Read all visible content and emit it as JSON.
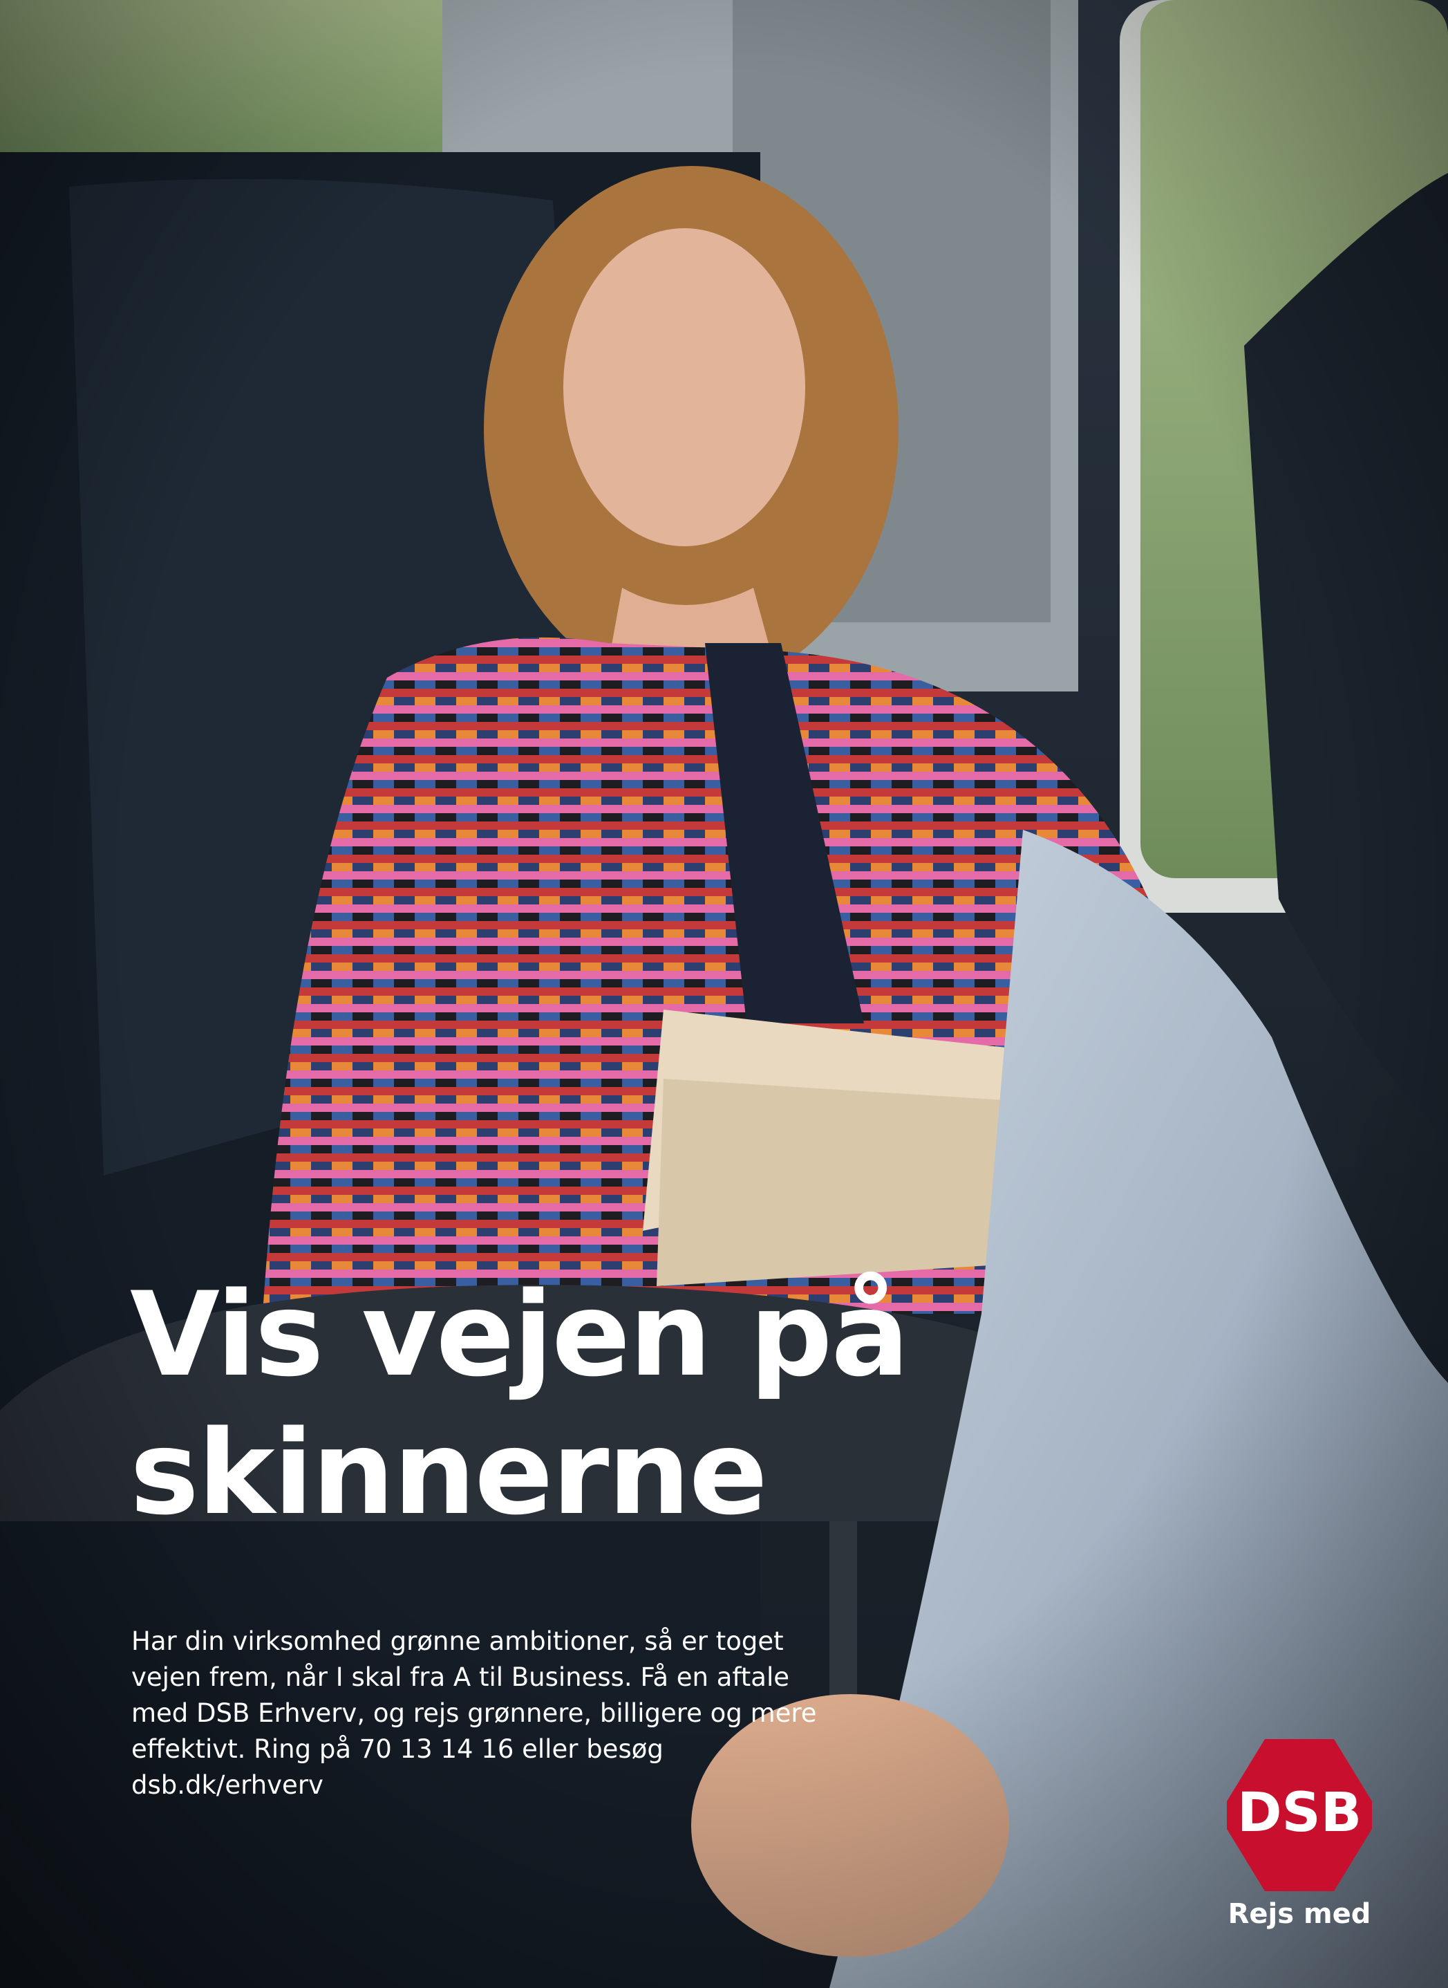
{
  "headline": {
    "line1": "Vis vejen på",
    "line2": "skinnerne"
  },
  "body_text": "Har din virksomhed grønne ambitioner, så er toget vejen frem, når I skal fra A til Business. Få en aftale med DSB Erhverv, og rejs grønnere, billigere og mere effektivt. Ring på 70 13 14 16 eller besøg dsb.dk/erhverv",
  "logo": {
    "text": "DSB",
    "tagline": "Rejs med",
    "color": "#c8102e"
  },
  "photo": {
    "description_icon": "woman-on-train-photo",
    "colors": {
      "window_green": "#8fa874",
      "seat": "#1a2430",
      "shirt": "#b9c7d6"
    }
  }
}
